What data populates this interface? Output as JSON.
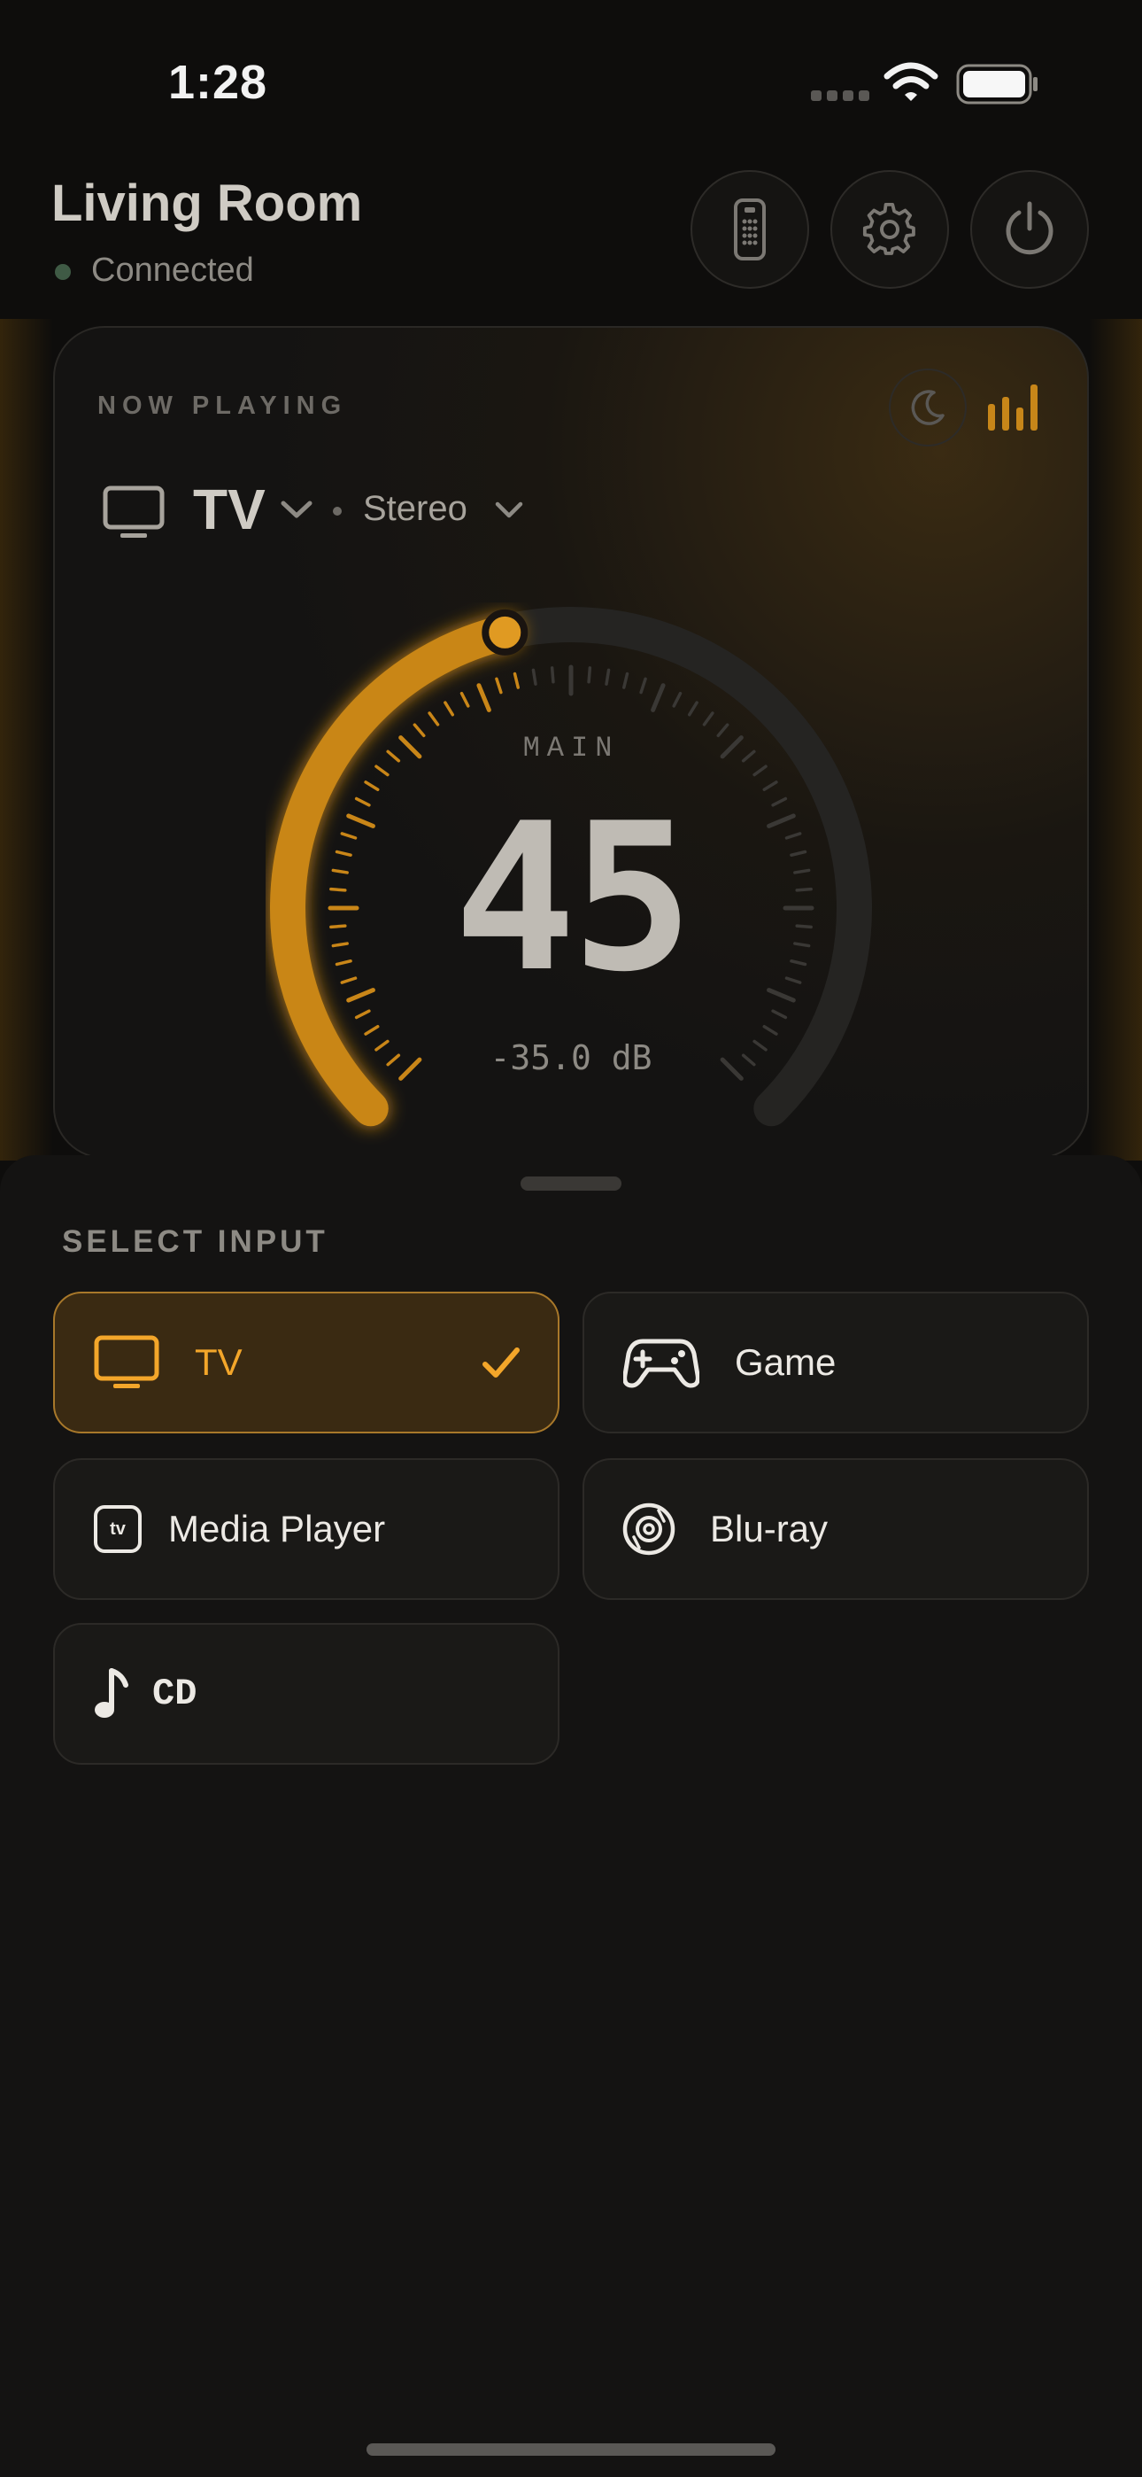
{
  "status": {
    "time": "1:28"
  },
  "header": {
    "room": "Living Room",
    "connection": "Connected"
  },
  "header_buttons": [
    {
      "icon": "remote-icon"
    },
    {
      "icon": "gear-icon"
    },
    {
      "icon": "power-icon"
    }
  ],
  "now_playing": {
    "label": "NOW PLAYING",
    "source": "TV",
    "mode": "Stereo",
    "dial_label": "MAIN",
    "volume": "45",
    "volume_db": "-35.0 dB",
    "volume_fraction": 0.45
  },
  "select_input": {
    "label": "SELECT INPUT",
    "inputs": [
      {
        "label": "TV",
        "icon": "tv-icon",
        "selected": true
      },
      {
        "label": "Game",
        "icon": "gamepad-icon",
        "selected": false
      },
      {
        "label": "Media Player",
        "icon": "apple-tv-icon",
        "selected": false
      },
      {
        "label": "Blu-ray",
        "icon": "disc-icon",
        "selected": false
      },
      {
        "label": "CD",
        "icon": "music-note-icon",
        "selected": false
      }
    ],
    "apple_tv_badge": "tv"
  },
  "colors": {
    "accent": "#e0961f",
    "background": "#0e0d0c",
    "card": "#141312"
  }
}
